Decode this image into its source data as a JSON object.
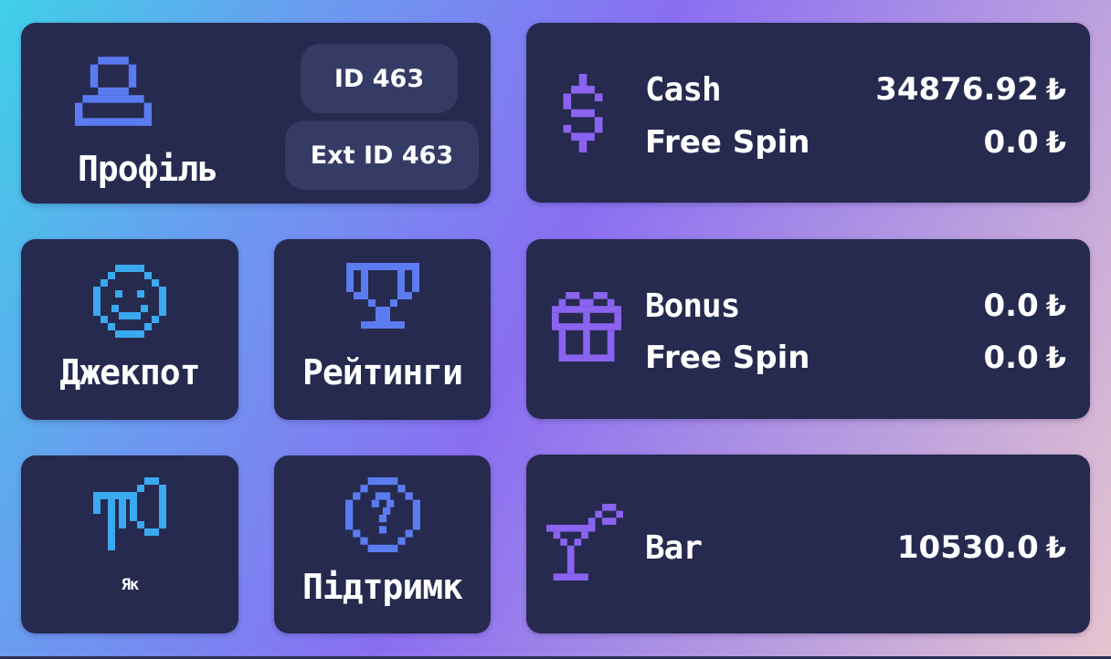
{
  "profile": {
    "label": "Профіль",
    "id": "ID 463",
    "ext_id": "Ext ID 463"
  },
  "tiles": {
    "jackpot": "Джекпот",
    "ratings": "Рейтинги",
    "how": "Як",
    "support": "Підтримк"
  },
  "balances": {
    "cash": {
      "label": "Cash",
      "value": "34876.92",
      "free_label": "Free Spin",
      "free_value": "0.0"
    },
    "bonus": {
      "label": "Bonus",
      "value": "0.0",
      "free_label": "Free Spin",
      "free_value": "0.0"
    },
    "bar": {
      "label": "Bar",
      "value": "10530.0"
    }
  },
  "currency_symbol": "₺",
  "colors": {
    "card": "#262a4f",
    "pill": "#363b66",
    "accent_purple": "#8a63f0",
    "accent_blue": "#5b7cf0",
    "accent_cyan": "#3aa9f0"
  },
  "icons": {
    "profile": "user-icon",
    "cash": "dollar-icon",
    "jackpot": "smiley-icon",
    "ratings": "trophy-icon",
    "bonus": "gift-icon",
    "how": "megaphone-icon",
    "support": "question-icon",
    "bar": "cocktail-icon"
  }
}
